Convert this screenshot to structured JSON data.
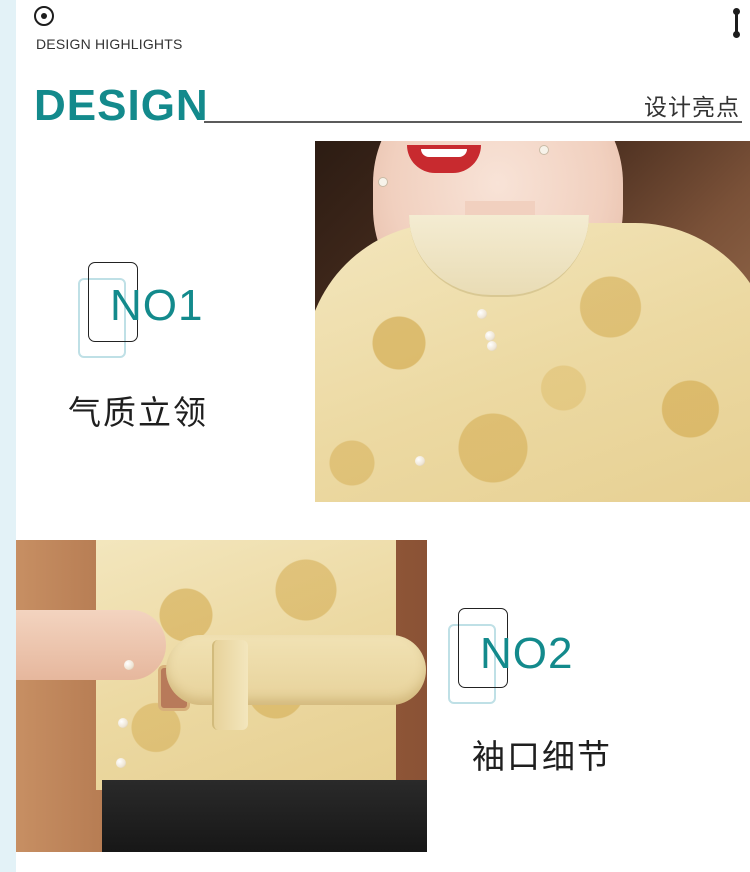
{
  "header": {
    "highlights_label": "DESIGN HIGHLIGHTS",
    "title": "DESIGN",
    "title_cn": "设计亮点"
  },
  "features": [
    {
      "number": "NO1",
      "name": "气质立领"
    },
    {
      "number": "NO2",
      "name": "袖口细节"
    }
  ],
  "colors": {
    "accent_teal": "#138a8c",
    "stripe": "#e3f2f7",
    "badge_back": "#bfe0e6",
    "fabric_gold": "#ecd9a2"
  },
  "icons": {
    "top_left": "target-circle-icon",
    "top_right": "vertical-dots-icon"
  }
}
